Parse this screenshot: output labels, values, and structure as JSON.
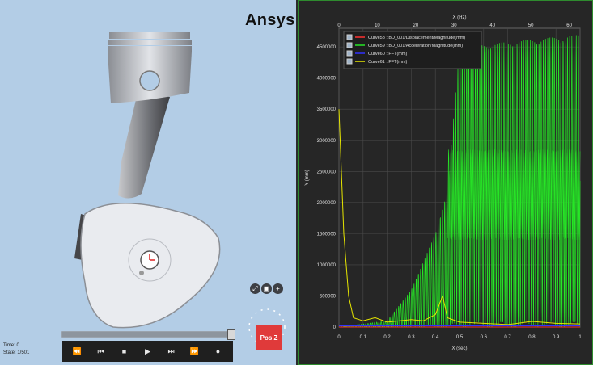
{
  "brand": {
    "name": "Ansys"
  },
  "viewport": {
    "time_label": "Time: 0",
    "state_label": "State: 1/501",
    "slider": {
      "progress": 0.98
    },
    "playback": [
      "⏪",
      "⏮",
      "■",
      "▶",
      "⏭",
      "⏩",
      "●"
    ],
    "view_buttons": [
      "⤢",
      "▣",
      "+"
    ],
    "orientation": {
      "label": "Pos Z"
    }
  },
  "chart_data": {
    "type": "line",
    "x_top_label": "X (Hz)",
    "x_top_ticks": [
      "0",
      "10",
      "20",
      "30",
      "40",
      "50",
      "60"
    ],
    "xlabel": "X (sec)",
    "x_ticks": [
      "0",
      "0.1",
      "0.2",
      "0.3",
      "0.4",
      "0.5",
      "0.6",
      "0.7",
      "0.8",
      "0.9",
      "1"
    ],
    "ylabel": "Y (mm)",
    "y_ticks": [
      "0",
      "500000",
      "1000000",
      "1500000",
      "2000000",
      "2500000",
      "3000000",
      "3500000",
      "4000000",
      "4500000"
    ],
    "xlim": [
      0,
      1
    ],
    "ylim": [
      0,
      4800000
    ],
    "grid": true,
    "legend_position": "top-left",
    "series": [
      {
        "name": "Curve58 : BD_001/Displacement/Magnitude(mm)",
        "color": "#ff3030",
        "values": [
          [
            0,
            0
          ],
          [
            1,
            0
          ]
        ]
      },
      {
        "name": "Curve59 : BD_001/Acceleration/Magnitude(mm)",
        "color": "#27e627",
        "values": [
          [
            0,
            0
          ],
          [
            0.2,
            100000
          ],
          [
            0.3,
            600000
          ],
          [
            0.4,
            1500000
          ],
          [
            0.45,
            2200000
          ],
          [
            0.5,
            4500000
          ],
          [
            1,
            4700000
          ]
        ]
      },
      {
        "name": "Curve60 : FFT(mm)",
        "color": "#3030ff",
        "values": [
          [
            0,
            20000
          ],
          [
            1,
            20000
          ]
        ]
      },
      {
        "name": "Curve61 : FFT(mm)",
        "color": "#e6e600",
        "values": [
          [
            0,
            3500000
          ],
          [
            0.02,
            1500000
          ],
          [
            0.04,
            500000
          ],
          [
            0.06,
            150000
          ],
          [
            0.1,
            100000
          ],
          [
            0.15,
            150000
          ],
          [
            0.2,
            80000
          ],
          [
            0.3,
            120000
          ],
          [
            0.35,
            100000
          ],
          [
            0.4,
            200000
          ],
          [
            0.43,
            500000
          ],
          [
            0.45,
            150000
          ],
          [
            0.5,
            80000
          ],
          [
            0.6,
            60000
          ],
          [
            0.7,
            40000
          ],
          [
            0.8,
            90000
          ],
          [
            0.9,
            60000
          ],
          [
            1,
            50000
          ]
        ]
      }
    ]
  }
}
